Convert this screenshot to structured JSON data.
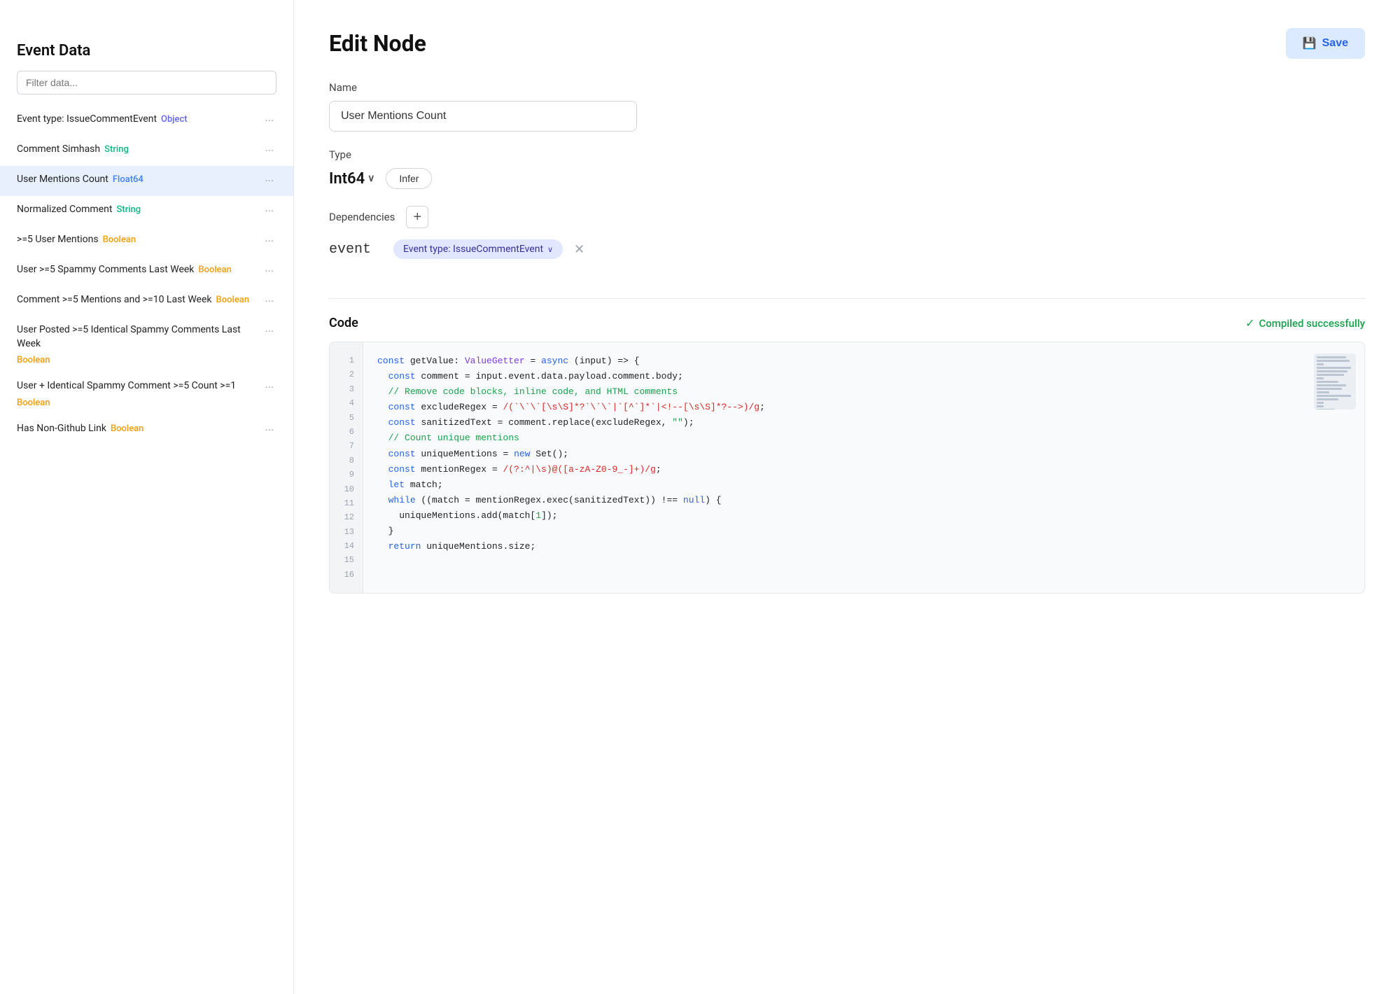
{
  "sidebar": {
    "title": "Event Data",
    "filter_placeholder": "Filter data...",
    "items": [
      {
        "id": "event-type-issue",
        "label": "Event type: IssueCommentEvent",
        "type": "Object",
        "type_class": "type-object",
        "active": false
      },
      {
        "id": "comment-simhash",
        "label": "Comment Simhash",
        "type": "String",
        "type_class": "type-string",
        "active": false
      },
      {
        "id": "user-mentions-count",
        "label": "User Mentions Count",
        "type": "Float64",
        "type_class": "type-float64",
        "active": true
      },
      {
        "id": "normalized-comment",
        "label": "Normalized Comment",
        "type": "String",
        "type_class": "type-string",
        "active": false
      },
      {
        "id": "gte5-user-mentions",
        "label": ">=5 User Mentions",
        "type": "Boolean",
        "type_class": "type-boolean",
        "active": false
      },
      {
        "id": "gte5-spammy-comments",
        "label": "User >=5 Spammy Comments Last Week",
        "type": "Boolean",
        "type_class": "type-boolean",
        "active": false
      },
      {
        "id": "comment-mentions-lastweek",
        "label": "Comment >=5 Mentions and >=10 Last Week",
        "type": "Boolean",
        "type_class": "type-boolean",
        "active": false
      },
      {
        "id": "user-posted-identical",
        "label": "User Posted >=5 Identical Spammy Comments Last Week",
        "type": "Boolean",
        "type_class": "type-boolean",
        "active": false
      },
      {
        "id": "user-identical-spammy",
        "label": "User + Identical Spammy Comment >=5 Count >=1",
        "type": "Boolean",
        "type_class": "type-boolean",
        "active": false
      },
      {
        "id": "has-non-github-link",
        "label": "Has Non-Github Link",
        "type": "Boolean",
        "type_class": "type-boolean",
        "active": false
      }
    ]
  },
  "main": {
    "page_title": "Edit Node",
    "save_button_label": "Save",
    "name_label": "Name",
    "name_value": "User Mentions Count",
    "type_label": "Type",
    "type_value": "Int64",
    "infer_button_label": "Infer",
    "deps_label": "Dependencies",
    "dep_item_label": "event",
    "dep_chip_label": "Event type: IssueCommentEvent",
    "code_title": "Code",
    "compile_status": "Compiled successfully",
    "code_lines": [
      {
        "num": 1,
        "html": "<span class='kw'>const</span> getValue: <span class='type-ann'>ValueGetter</span> = <span class='kw'>async</span> (input) => {"
      },
      {
        "num": 2,
        "html": "  <span class='kw'>const</span> comment = input.event.data.payload.comment.body;"
      },
      {
        "num": 3,
        "html": ""
      },
      {
        "num": 4,
        "html": "  <span class='cmt'>// Remove code blocks, inline code, and HTML comments</span>"
      },
      {
        "num": 5,
        "html": "  <span class='kw'>const</span> excludeRegex = <span class='regex'>/(`\\`\\`[\\s\\S]*?`\\`\\`|`[^`]*`|&lt;!--[\\s\\S]*?--&gt;)/g</span>;"
      },
      {
        "num": 6,
        "html": "  <span class='kw'>const</span> sanitizedText = comment.replace(excludeRegex, <span class='str'>&quot;&quot;</span>);"
      },
      {
        "num": 7,
        "html": ""
      },
      {
        "num": 8,
        "html": "  <span class='cmt'>// Count unique mentions</span>"
      },
      {
        "num": 9,
        "html": "  <span class='kw'>const</span> uniqueMentions = <span class='kw'>new</span> Set();"
      },
      {
        "num": 10,
        "html": "  <span class='kw'>const</span> mentionRegex = <span class='regex'>/(?:^|\\s)@([a-zA-Z0-9_-]+)/g</span>;"
      },
      {
        "num": 11,
        "html": "  <span class='kw'>let</span> match;"
      },
      {
        "num": 12,
        "html": "  <span class='kw'>while</span> ((match = mentionRegex.exec(sanitizedText)) !== <span class='kw'>null</span>) {"
      },
      {
        "num": 13,
        "html": "    uniqueMentions.add(match[<span class='str'>1</span>]);"
      },
      {
        "num": 14,
        "html": "  }"
      },
      {
        "num": 15,
        "html": ""
      },
      {
        "num": 16,
        "html": "  <span class='kw'>return</span> uniqueMentions.size;"
      }
    ]
  }
}
